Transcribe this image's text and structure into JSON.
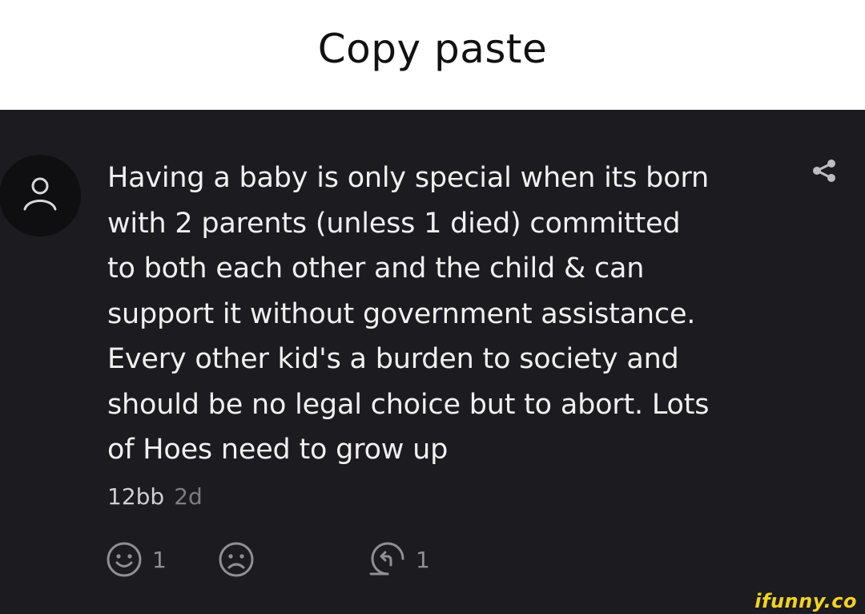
{
  "caption": "Copy paste",
  "comment": {
    "text": "Having a baby is only special when its born\nwith 2 parents (unless 1 died) committed\nto both each other and the child & can\nsupport it without government assistance.\nEvery other kid's a burden to society and\nshould be no legal choice but to abort. Lots\nof Hoes need to grow up",
    "username": "12bb",
    "time": "2d",
    "like_count": "1",
    "reply_count": "1"
  },
  "watermark": "ifunny.co",
  "colors": {
    "background": "#1b1b20",
    "text": "#f0f0f0",
    "muted": "#8f8f94",
    "watermark": "#f2d21e"
  },
  "icons": {
    "avatar": "user-placeholder-icon",
    "share": "share-icon",
    "like": "smile-icon",
    "dislike": "frown-icon",
    "reply": "reply-icon"
  }
}
